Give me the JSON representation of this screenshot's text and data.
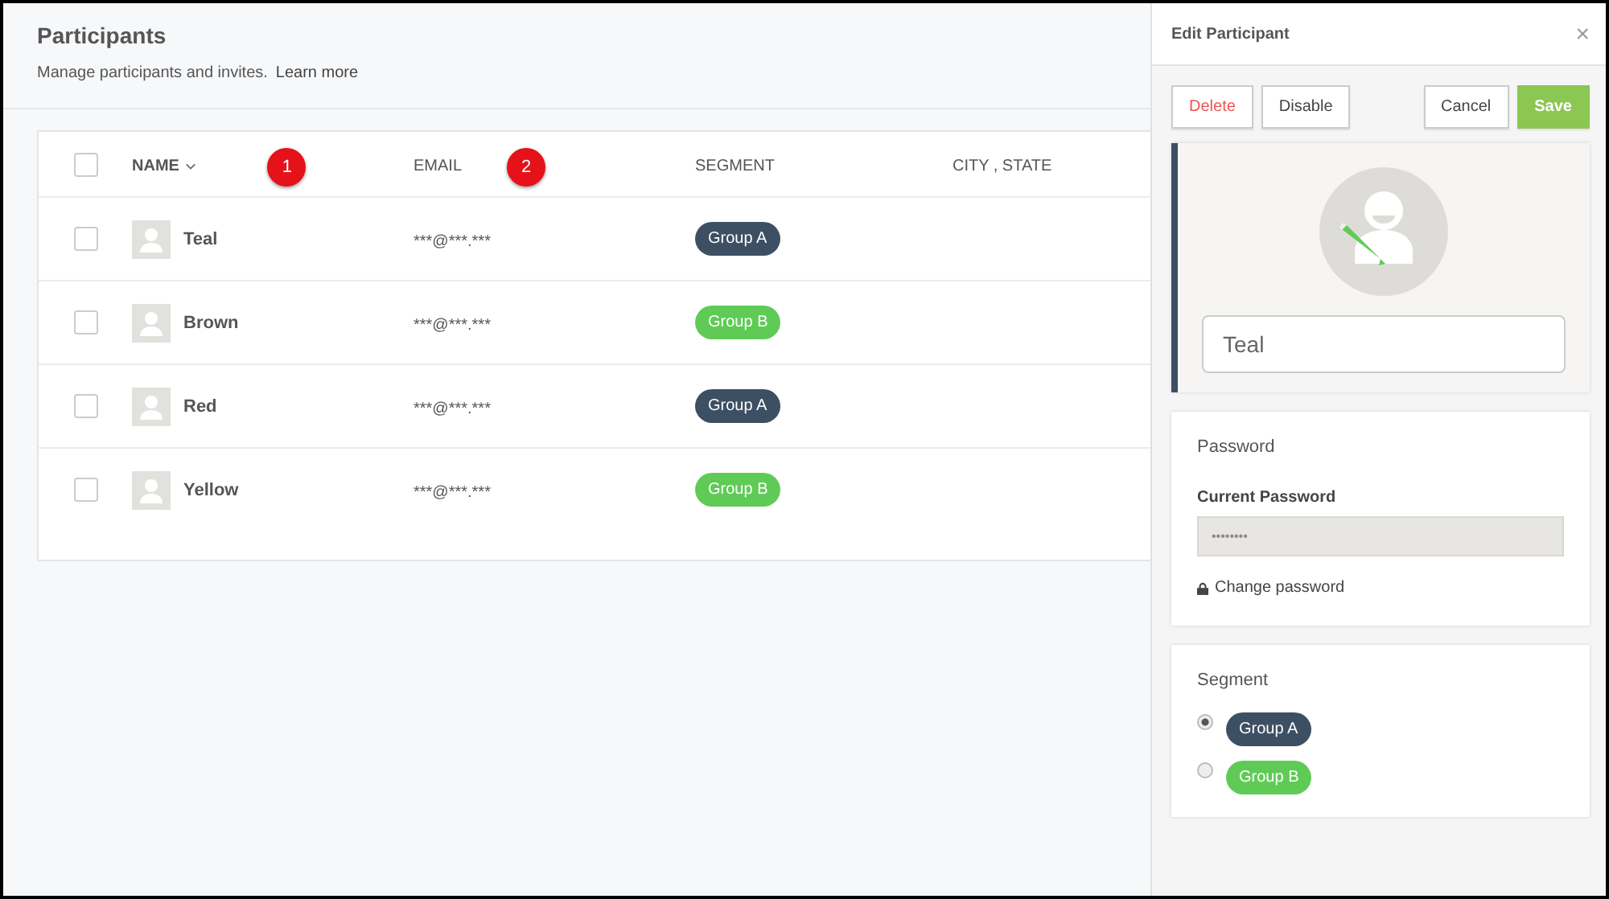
{
  "page": {
    "title": "Participants",
    "subtitle": "Manage participants and invites.",
    "learn_more": "Learn more"
  },
  "table": {
    "select_all": {
      "checked": false
    },
    "columns": [
      {
        "label": "NAME",
        "sortable": true,
        "marker": "1"
      },
      {
        "label": "EMAIL",
        "sortable": false,
        "marker": "2"
      },
      {
        "label": "SEGMENT",
        "sortable": false
      },
      {
        "label": "CITY , STATE",
        "sortable": false
      }
    ],
    "rows": [
      {
        "checked": false,
        "name": "Teal",
        "email": "***@***.***",
        "segment": {
          "label": "Group A",
          "color": "#3d4f63"
        }
      },
      {
        "checked": false,
        "name": "Brown",
        "email": "***@***.***",
        "segment": {
          "label": "Group B",
          "color": "#5fcb56"
        }
      },
      {
        "checked": false,
        "name": "Red",
        "email": "***@***.***",
        "segment": {
          "label": "Group A",
          "color": "#3d4f63"
        }
      },
      {
        "checked": false,
        "name": "Yellow",
        "email": "***@***.***",
        "segment": {
          "label": "Group B",
          "color": "#5fcb56"
        }
      }
    ]
  },
  "panel": {
    "title": "Edit Participant",
    "close": "×",
    "buttons": [
      {
        "label": "Delete",
        "kind": "danger"
      },
      {
        "label": "Disable",
        "kind": "default"
      },
      {
        "label": "Cancel",
        "kind": "default"
      },
      {
        "label": "Save",
        "kind": "primary"
      }
    ],
    "name_value": "Teal",
    "password": {
      "heading": "Password",
      "label": "Current Password",
      "value": "••••••••",
      "change_link": "Change password"
    },
    "segment": {
      "heading": "Segment",
      "options": [
        {
          "label": "Group A",
          "color": "#3d4f63",
          "selected": true
        },
        {
          "label": "Group B",
          "color": "#5fcb56",
          "selected": false
        }
      ]
    }
  }
}
